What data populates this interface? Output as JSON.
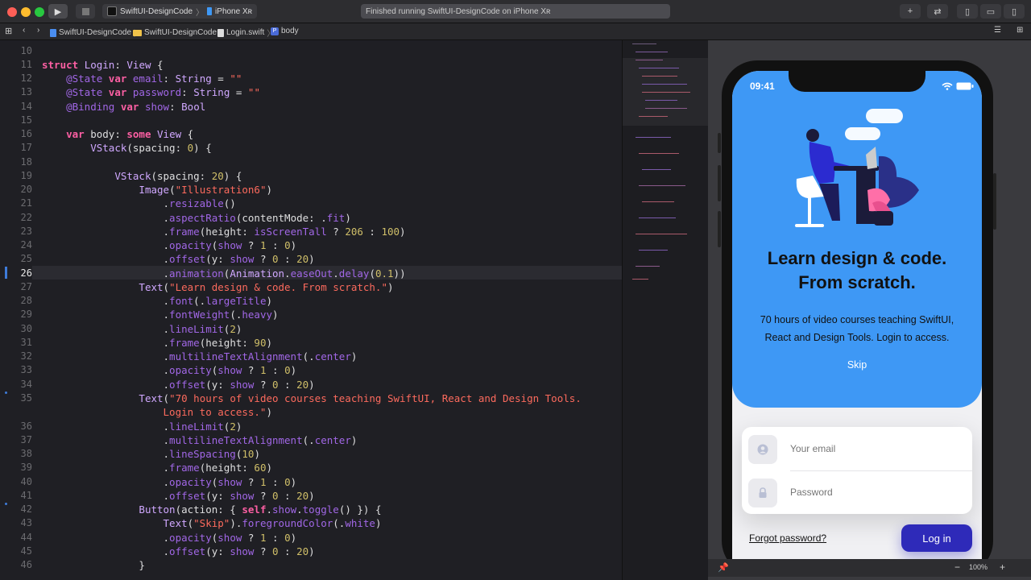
{
  "toolbar": {
    "scheme_target": "SwiftUI-DesignCode",
    "scheme_device": "iPhone Xʀ",
    "status_text": "Finished running SwiftUI-DesignCode on iPhone Xʀ"
  },
  "pathbar": {
    "crumbs": [
      "SwiftUI-DesignCode",
      "SwiftUI-DesignCode",
      "Login.swift",
      "body"
    ]
  },
  "editor": {
    "line_numbers": [
      "10",
      "11",
      "12",
      "13",
      "14",
      "15",
      "16",
      "17",
      "18",
      "19",
      "20",
      "21",
      "22",
      "23",
      "24",
      "25",
      "26",
      "27",
      "28",
      "29",
      "30",
      "31",
      "32",
      "33",
      "34",
      "35",
      "",
      "36",
      "37",
      "38",
      "39",
      "40",
      "41",
      "42",
      "43",
      "44",
      "45",
      "46"
    ],
    "current_line": "26"
  },
  "preview": {
    "time": "09:41",
    "title_line1": "Learn design & code.",
    "title_line2": "From scratch.",
    "subtitle_line1": "70 hours of video courses teaching SwiftUI,",
    "subtitle_line2": "React and Design Tools. Login to access.",
    "skip_label": "Skip",
    "email_placeholder": "Your email",
    "password_placeholder": "Password",
    "forgot_label": "Forgot password?",
    "login_label": "Log in"
  },
  "bottom": {
    "zoom": "100%"
  },
  "colors": {
    "preview_blue": "#3e98f5",
    "login_button": "#2e2ab9",
    "keyword": "#fc5fa3",
    "string": "#fc6a5d"
  }
}
